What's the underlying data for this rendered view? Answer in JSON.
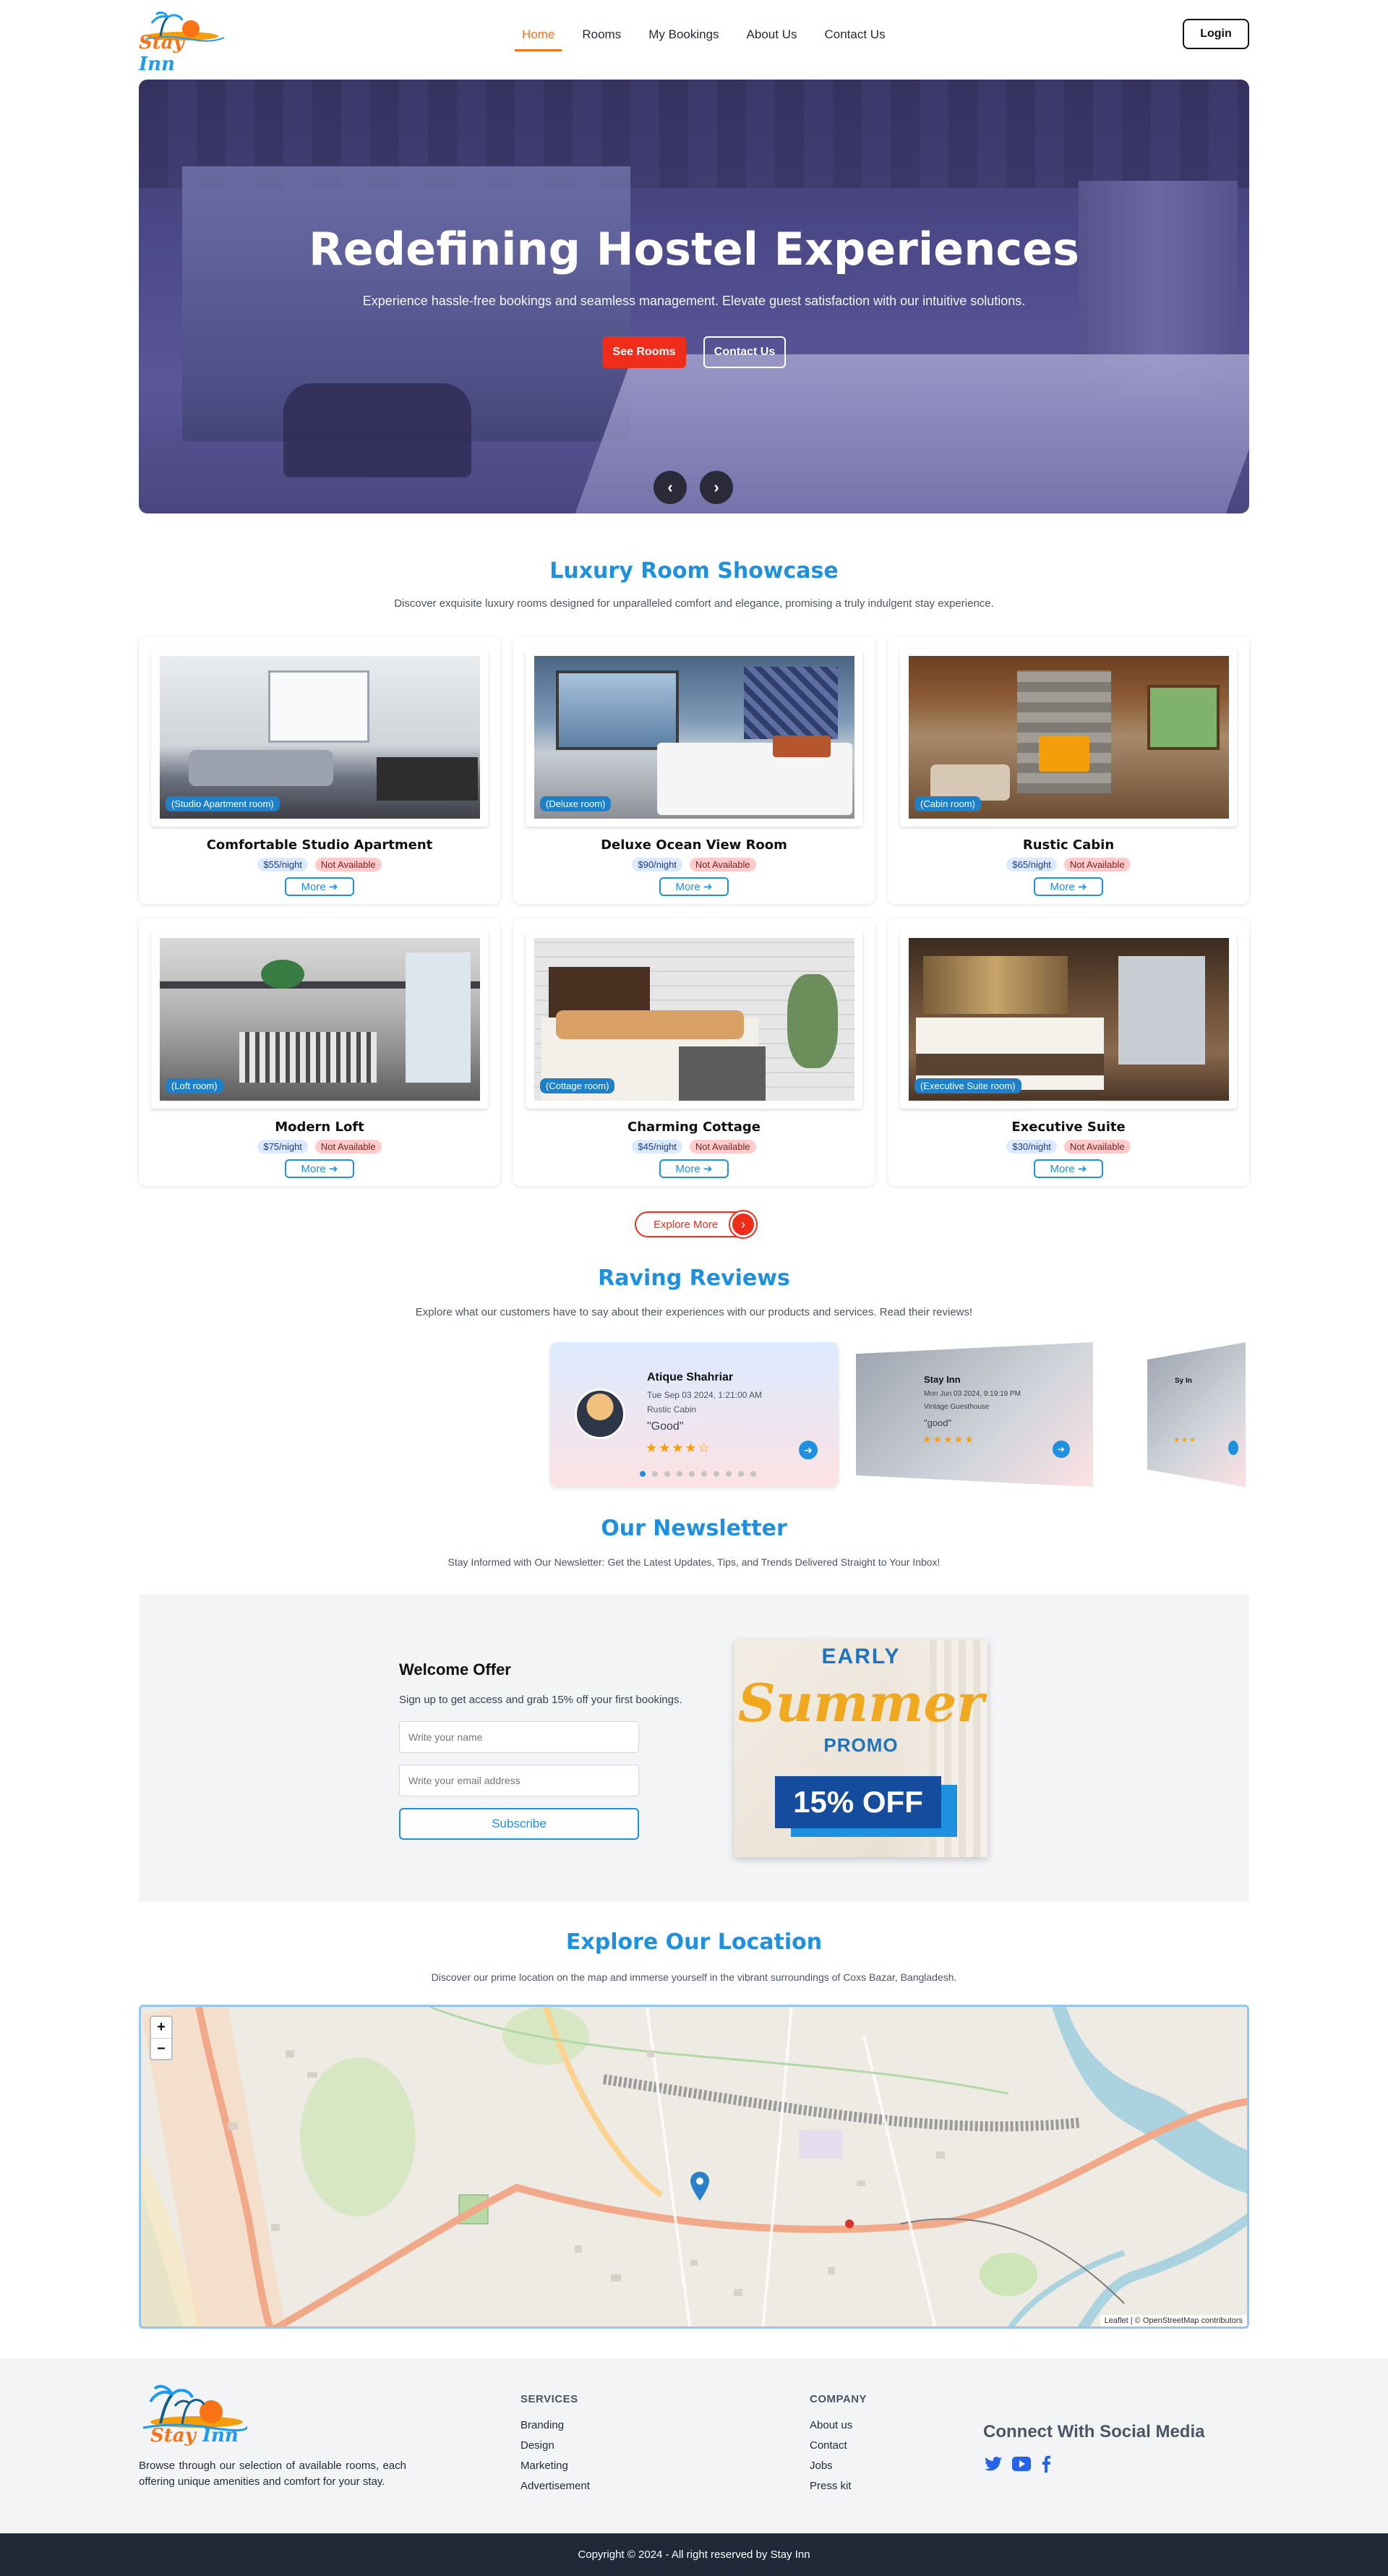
{
  "brand": {
    "logo_word1": "Stay",
    "logo_word2": "Inn"
  },
  "nav": {
    "items": [
      {
        "label": "Home",
        "active": true
      },
      {
        "label": "Rooms"
      },
      {
        "label": "My Bookings"
      },
      {
        "label": "About Us"
      },
      {
        "label": "Contact Us"
      }
    ],
    "login": "Login"
  },
  "hero": {
    "title": "Redefining Hostel Experiences",
    "subtitle": "Experience hassle-free bookings and seamless management. Elevate guest satisfaction with our intuitive solutions.",
    "primary_btn": "See Rooms",
    "secondary_btn": "Contact Us",
    "prev_icon": "‹",
    "next_icon": "›"
  },
  "showcase": {
    "title": "Luxury Room Showcase",
    "description": "Discover exquisite luxury rooms designed for unparalleled comfort and elegance, promising a truly indulgent stay experience.",
    "more_label": "More",
    "explore_label": "Explore More",
    "rooms": [
      {
        "tag": "(Studio Apartment room)",
        "name": "Comfortable Studio Apartment",
        "price": "$55/night",
        "status": "Not Available"
      },
      {
        "tag": "(Deluxe room)",
        "name": "Deluxe Ocean View Room",
        "price": "$90/night",
        "status": "Not Available"
      },
      {
        "tag": "(Cabin room)",
        "name": "Rustic Cabin",
        "price": "$65/night",
        "status": "Not Available"
      },
      {
        "tag": "(Loft room)",
        "name": "Modern Loft",
        "price": "$75/night",
        "status": "Not Available"
      },
      {
        "tag": "(Cottage room)",
        "name": "Charming Cottage",
        "price": "$45/night",
        "status": "Not Available"
      },
      {
        "tag": "(Executive Suite room)",
        "name": "Executive Suite",
        "price": "$30/night",
        "status": "Not Available"
      }
    ]
  },
  "reviews": {
    "title": "Raving Reviews",
    "description": "Explore what our customers have to say about their experiences with our products and services. Read their reviews!",
    "main": {
      "name": "Atique Shahriar",
      "date": "Tue Sep 03 2024, 1:21:00 AM",
      "room": "Rustic Cabin",
      "text": "\"Good\"",
      "rating": 4
    },
    "side": {
      "name": "Stay Inn",
      "date": "Mon Jun 03 2024, 9:19:19 PM",
      "room": "Vintage Guesthouse",
      "text": "\"good\"",
      "rating": 5
    },
    "dots": 10
  },
  "newsletter": {
    "title": "Our Newsletter",
    "description": "Stay Informed with Our Newsletter: Get the Latest Updates, Tips, and Trends Delivered Straight to Your Inbox!",
    "offer_title": "Welcome Offer",
    "offer_text": "Sign up to get access and grab 15% off your first bookings.",
    "name_placeholder": "Write your name",
    "email_placeholder": "Write your email address",
    "subscribe": "Subscribe",
    "promo": {
      "line1": "EARLY",
      "line2": "Summer",
      "line3": "PROMO",
      "line4": "15% OFF"
    }
  },
  "location": {
    "title": "Explore Our Location",
    "description": "Discover our prime location on the map and immerse yourself in the vibrant surroundings of Coxs Bazar, Bangladesh.",
    "zoom_in": "+",
    "zoom_out": "−",
    "attribution": "Leaflet | © OpenStreetMap contributors"
  },
  "footer": {
    "about": "Browse through our selection of available rooms, each offering unique amenities and comfort for your stay.",
    "services_head": "SERVICES",
    "services": [
      "Branding",
      "Design",
      "Marketing",
      "Advertisement"
    ],
    "company_head": "COMPANY",
    "company": [
      "About us",
      "Contact",
      "Jobs",
      "Press kit"
    ],
    "social_head": "Connect With Social Media",
    "social_icons": [
      "twitter-icon",
      "youtube-icon",
      "facebook-icon"
    ],
    "copyright": "Copyright © 2024 - All right reserved by Stay Inn"
  },
  "colors": {
    "accent": "#1e90e0",
    "brand_orange": "#f97316",
    "cta_red": "#ef2d1a",
    "footer_dark": "#1f2937"
  }
}
